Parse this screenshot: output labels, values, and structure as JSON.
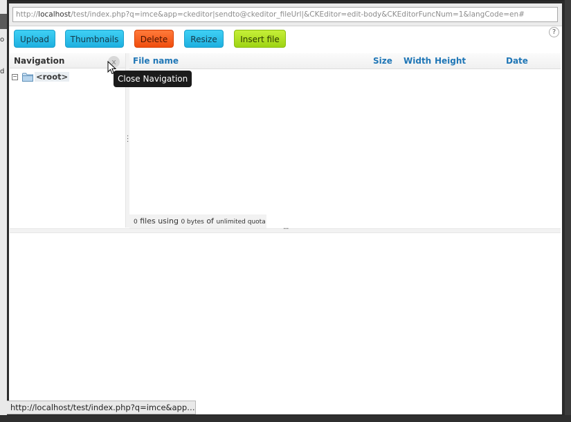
{
  "browser": {
    "url_host_prefix": "http://",
    "url_host": "localhost",
    "url_rest": "/test/index.php?q=imce&app=ckeditor|sendto@ckeditor_fileUrl|&CKEditor=edit-body&CKEditorFuncNum=1&langCode=en#",
    "status_url": "http://localhost/test/index.php?q=imce&app…"
  },
  "toolbar": {
    "upload_label": "Upload",
    "thumbnails_label": "Thumbnails",
    "delete_label": "Delete",
    "resize_label": "Resize",
    "insert_label": "Insert file",
    "help_label": "?"
  },
  "navigation": {
    "title": "Navigation",
    "close_label": "x",
    "tooltip": "Close Navigation",
    "tree": [
      {
        "toggle": "−",
        "label": "<root>"
      }
    ]
  },
  "file_list": {
    "columns": [
      "File name",
      "Size",
      "Width",
      "Height",
      "Date"
    ],
    "status": {
      "count": "0",
      "files_text": "files using",
      "bytes": "0 bytes",
      "of_text": "of",
      "quota": "unlimited quota"
    }
  },
  "background_fragments": [
    "o",
    "d"
  ],
  "colors": {
    "blue_button": "#1eb0e0",
    "delete_button": "#f04d0e",
    "insert_button": "#9ed414",
    "column_header_text": "#1f76b6"
  },
  "icons": {
    "folder": "folder-icon",
    "help": "help-icon",
    "close": "close-icon",
    "cursor": "mouse-pointer-icon"
  }
}
